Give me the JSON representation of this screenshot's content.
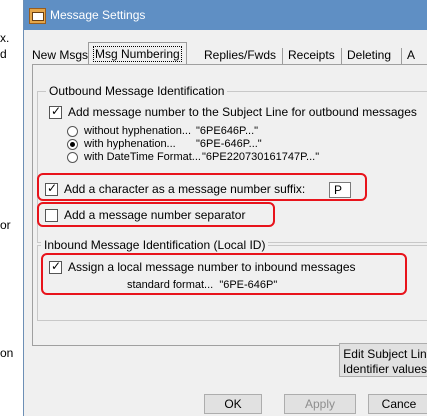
{
  "left_fragments": [
    "x.",
    "d",
    "or",
    "on"
  ],
  "window": {
    "title": "Message Settings"
  },
  "tabs": [
    {
      "label": "New Msgs"
    },
    {
      "label": "Msg Numbering"
    },
    {
      "label": "Replies/Fwds"
    },
    {
      "label": "Receipts"
    },
    {
      "label": "Deleting"
    },
    {
      "label": "A"
    }
  ],
  "outbound": {
    "group_label": "Outbound Message Identification",
    "add_to_subject": {
      "label": "Add message number to the Subject Line for outbound messages",
      "checked": true
    },
    "radios": [
      {
        "label": "without hyphenation...",
        "example": "\"6PE646P...\"",
        "checked": false
      },
      {
        "label": "with hyphenation...",
        "example": "\"6PE-646P...\"",
        "checked": true
      },
      {
        "label": "with DateTime Format...",
        "example": "\"6PE220730161747P...\"",
        "checked": false
      }
    ],
    "suffix": {
      "label": "Add a character as a message number suffix:",
      "checked": true,
      "value": "P"
    },
    "separator": {
      "label": "Add a message number separator",
      "checked": false
    }
  },
  "inbound": {
    "group_label": "Inbound Message Identification (Local ID)",
    "assign_local": {
      "label": "Assign a local message number to inbound messages",
      "checked": true
    },
    "format_text": "standard format...  \"6PE-646P\""
  },
  "buttons": {
    "edit_subject": [
      "Edit Subject Lin",
      "Identifier values"
    ],
    "ok": "OK",
    "apply": "Apply",
    "cancel": "Cance"
  },
  "colors": {
    "titlebar": "#5f8fc4",
    "highlight": "#e8131b",
    "window_bg": "#f0f0f0"
  }
}
